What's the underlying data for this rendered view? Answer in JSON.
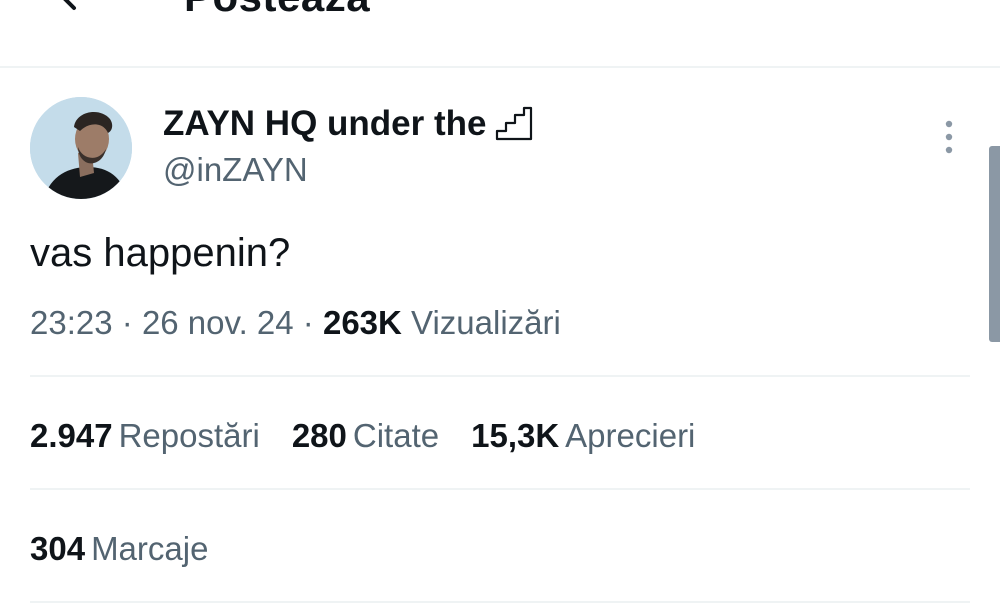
{
  "header": {
    "title": "Postează",
    "back_icon": "arrow-left-icon"
  },
  "tweet": {
    "display_name": "ZAYN HQ under the",
    "name_icon": "stairs-icon",
    "handle": "@inZAYN",
    "text": "vas happenin?",
    "time": "23:23",
    "separator": "·",
    "date": "26 nov. 24",
    "views_count": "263K",
    "views_label": "Vizualizări",
    "menu_icon": "more-vertical-icon"
  },
  "stats": {
    "reposts_count": "2.947",
    "reposts_label": "Repostări",
    "quotes_count": "280",
    "quotes_label": "Citate",
    "likes_count": "15,3K",
    "likes_label": "Aprecieri",
    "bookmarks_count": "304",
    "bookmarks_label": "Marcaje"
  },
  "colors": {
    "text_primary": "#0f1419",
    "text_secondary": "#536471",
    "divider": "#eff3f4",
    "scrollbar": "#8b98a5"
  }
}
